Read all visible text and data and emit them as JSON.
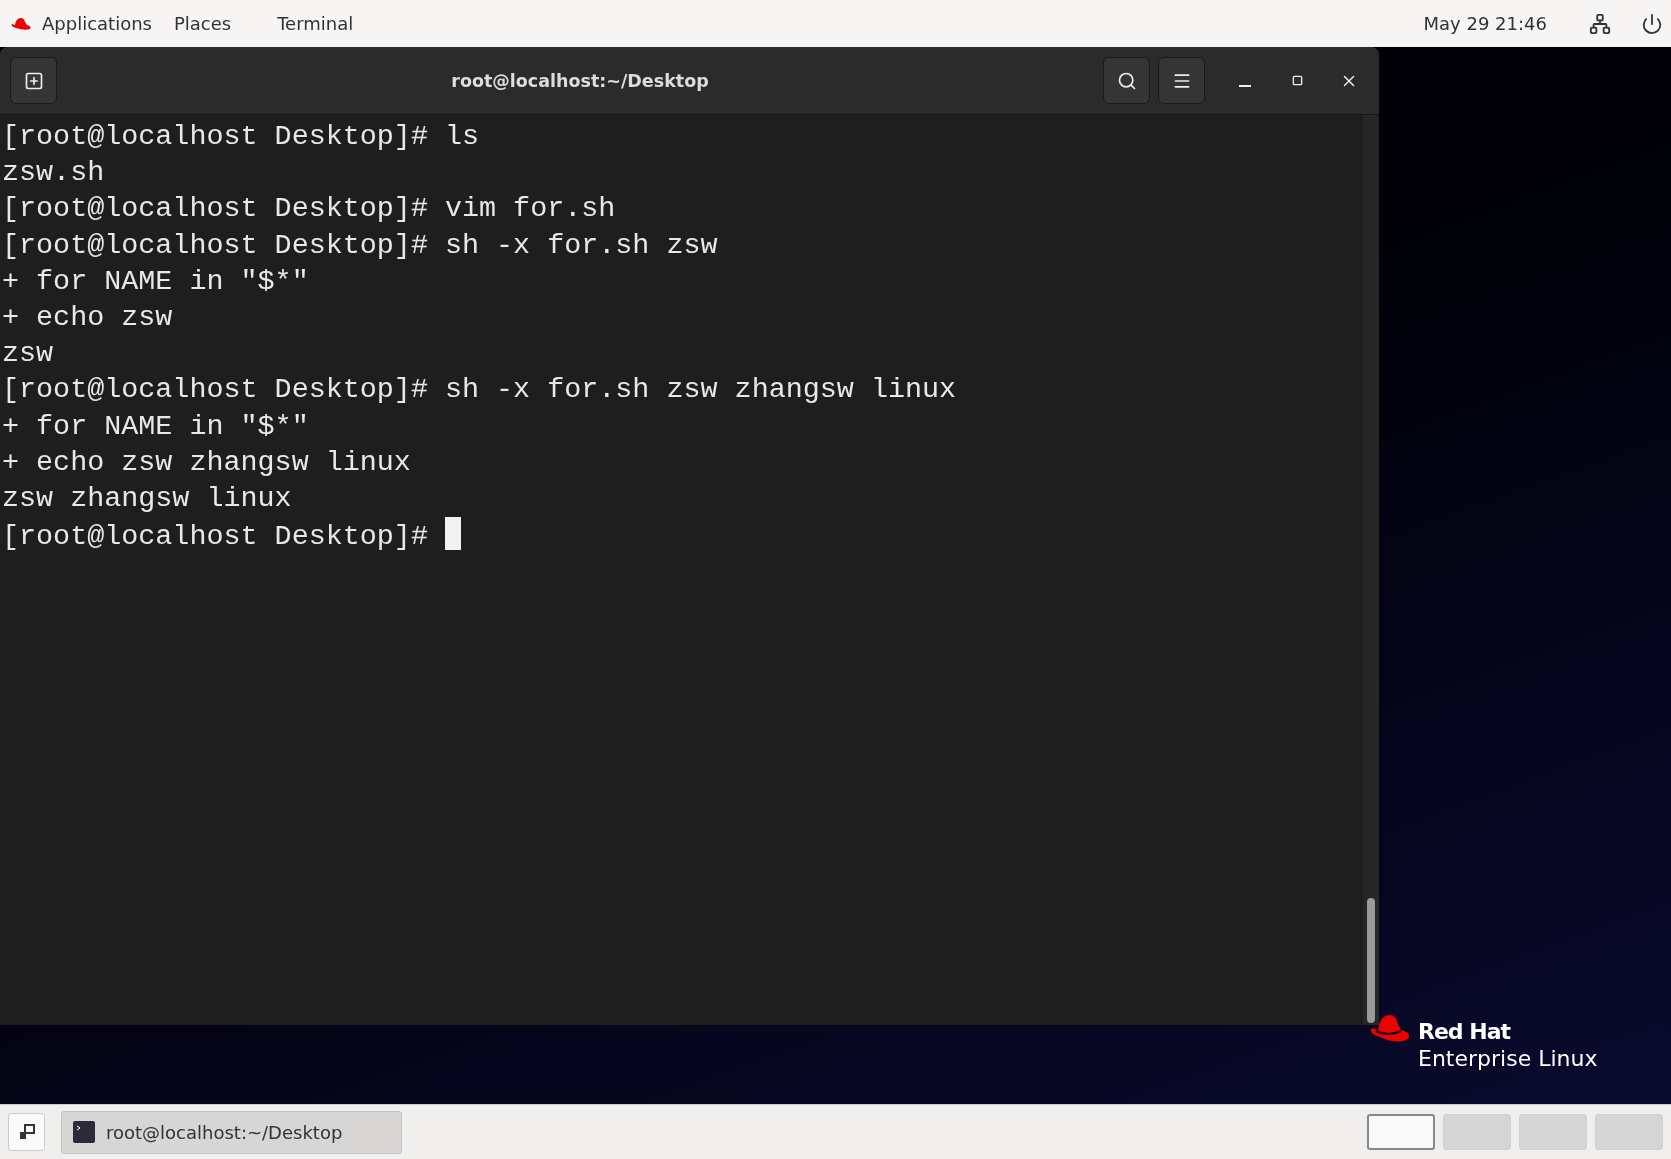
{
  "top_bar": {
    "menus": [
      {
        "label": "Applications"
      },
      {
        "label": "Places"
      },
      {
        "label": "Terminal"
      }
    ],
    "clock": "May 29  21:46"
  },
  "window": {
    "title": "root@localhost:~/Desktop"
  },
  "terminal": {
    "lines": [
      "[root@localhost Desktop]# ls",
      "zsw.sh",
      "[root@localhost Desktop]# vim for.sh",
      "[root@localhost Desktop]# sh -x for.sh zsw",
      "+ for NAME in \"$*\"",
      "+ echo zsw",
      "zsw",
      "[root@localhost Desktop]# sh -x for.sh zsw zhangsw linux",
      "+ for NAME in \"$*\"",
      "+ echo zsw zhangsw linux",
      "zsw zhangsw linux"
    ],
    "prompt": "[root@localhost Desktop]#",
    "cursor": true
  },
  "logo": {
    "line_1": "Red Hat",
    "line_2": "Enterprise Linux"
  },
  "taskbar": {
    "windows": [
      {
        "label": "root@localhost:~/Desktop"
      }
    ],
    "workspaces": [
      {
        "selected": true
      },
      {
        "selected": false
      },
      {
        "selected": false
      },
      {
        "selected": false
      }
    ]
  }
}
